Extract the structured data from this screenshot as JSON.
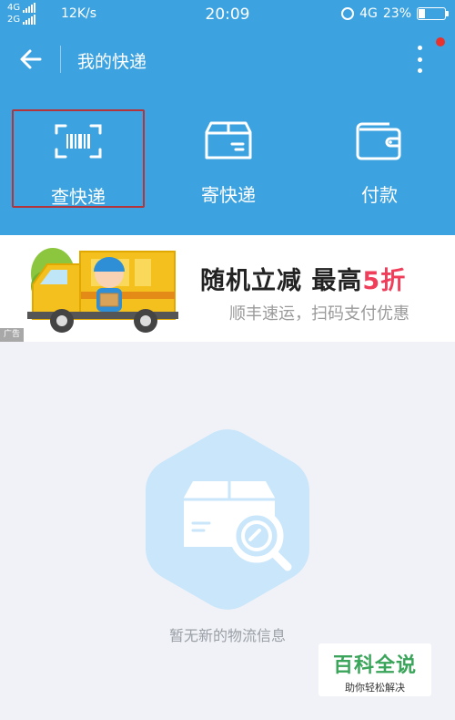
{
  "status_bar": {
    "network_top": "4G",
    "network_bottom": "2G",
    "speed": "12K/s",
    "time": "20:09",
    "network_right": "4G",
    "battery": "23%",
    "battery_level": 0.23
  },
  "app_bar": {
    "title": "我的快递",
    "back_icon": "arrow-left-icon",
    "menu_icon": "more-vertical-icon"
  },
  "actions": [
    {
      "label": "查快递",
      "icon": "barcode-scan-icon"
    },
    {
      "label": "寄快递",
      "icon": "parcel-box-icon"
    },
    {
      "label": "付款",
      "icon": "wallet-icon"
    }
  ],
  "ad": {
    "headline_main": "随机立减 最高",
    "headline_accent": "5折",
    "subtitle": "顺丰速运，扫码支付优惠",
    "tag": "广告"
  },
  "empty_state": {
    "message": "暂无新的物流信息"
  },
  "watermark": {
    "title": "百科全说",
    "subtitle": "助你轻松解决"
  },
  "colors": {
    "primary": "#3da3e0",
    "accent_red": "#ef3d5a",
    "empty_shape": "#c9e6fb",
    "watermark_green": "#3aa55a"
  }
}
